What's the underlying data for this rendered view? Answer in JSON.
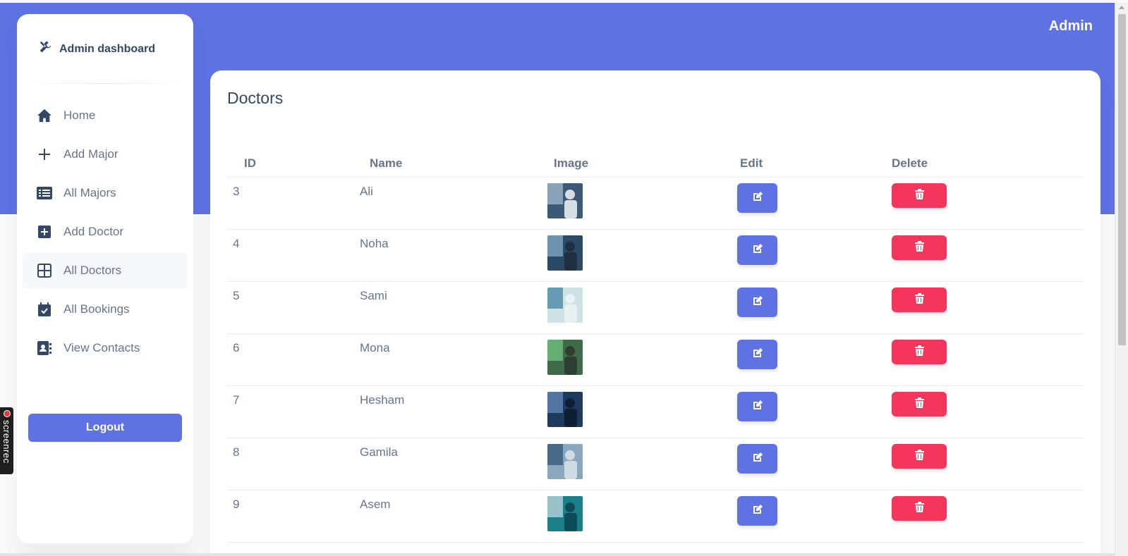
{
  "header": {
    "user_label": "Admin"
  },
  "sidebar": {
    "brand": "Admin dashboard",
    "items": [
      {
        "label": "Home",
        "icon": "home-icon",
        "active": false
      },
      {
        "label": "Add Major",
        "icon": "plus-icon",
        "active": false
      },
      {
        "label": "All Majors",
        "icon": "list-icon",
        "active": false
      },
      {
        "label": "Add Doctor",
        "icon": "plus-square-icon",
        "active": false
      },
      {
        "label": "All Doctors",
        "icon": "grid-icon",
        "active": true
      },
      {
        "label": "All Bookings",
        "icon": "calendar-check-icon",
        "active": false
      },
      {
        "label": "View Contacts",
        "icon": "address-book-icon",
        "active": false
      }
    ],
    "logout_label": "Logout"
  },
  "recorder": {
    "label": "screenrec"
  },
  "main": {
    "title": "Doctors",
    "columns": [
      "ID",
      "Name",
      "Image",
      "Edit",
      "Delete"
    ],
    "rows": [
      {
        "id": "3",
        "name": "Ali"
      },
      {
        "id": "4",
        "name": "Noha"
      },
      {
        "id": "5",
        "name": "Sami"
      },
      {
        "id": "6",
        "name": "Mona"
      },
      {
        "id": "7",
        "name": "Hesham"
      },
      {
        "id": "8",
        "name": "Gamila"
      },
      {
        "id": "9",
        "name": "Asem"
      }
    ]
  },
  "colors": {
    "primary": "#5e72e4",
    "danger": "#f5365c",
    "text": "#67748e",
    "heading": "#344767"
  }
}
